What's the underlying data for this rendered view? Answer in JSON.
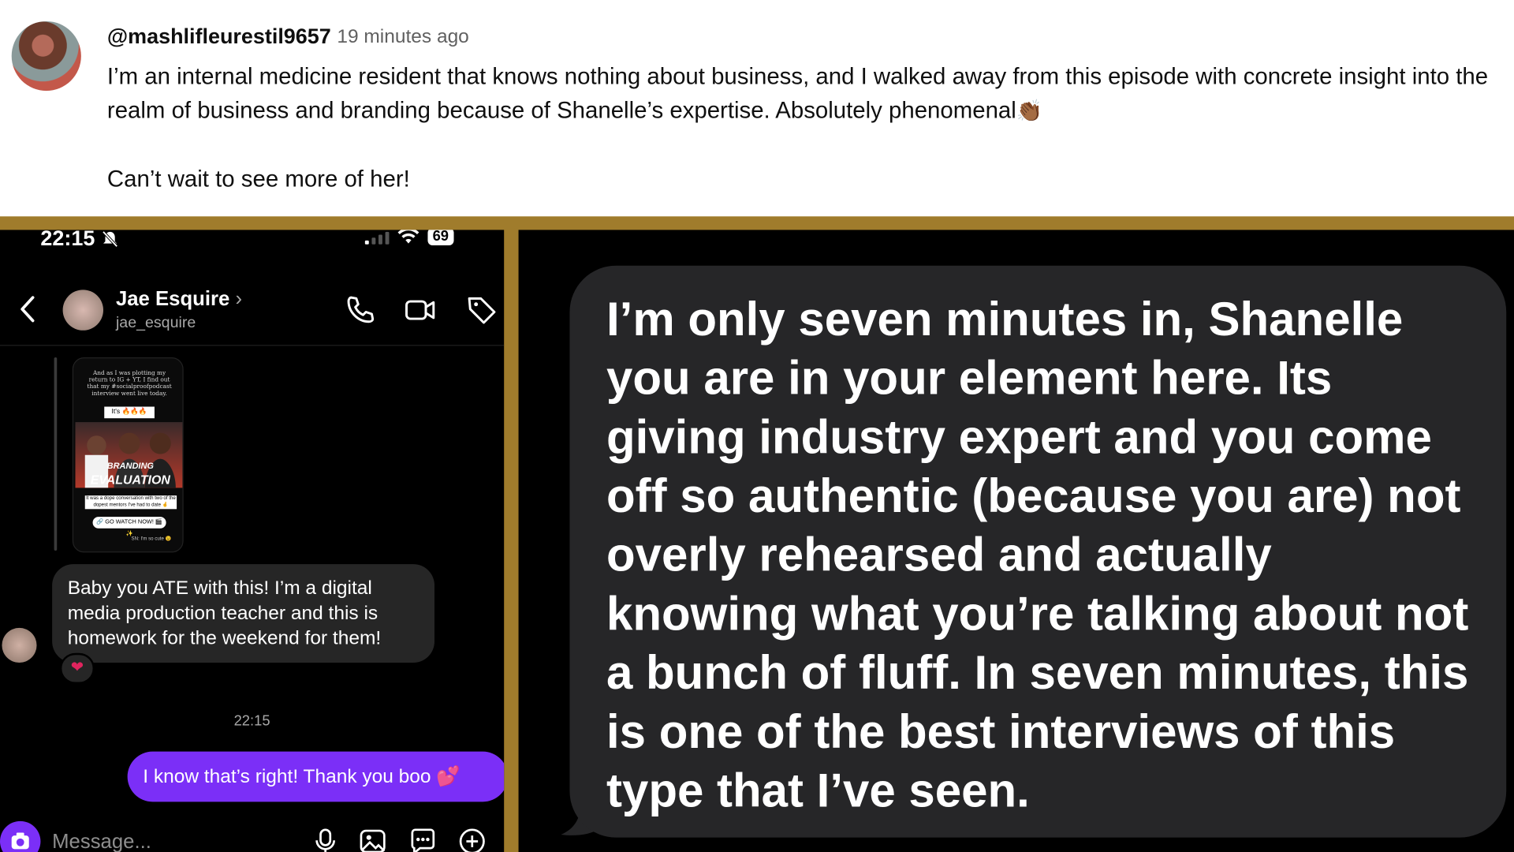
{
  "comment": {
    "handle": "@mashlifleurestil9657",
    "time_ago": "19 minutes ago",
    "text": "I’m an internal medicine resident that knows nothing about business, and I walked away from this episode with concrete insight into the realm of business and branding because of Shanelle’s expertise. Absolutely phenomenal",
    "emoji": "👏🏾",
    "text2": "Can’t wait to see more of her!"
  },
  "phone": {
    "status_time": "22:15",
    "battery": "69",
    "contact_name": "Jae Esquire",
    "contact_username": "jae_esquire",
    "story": {
      "caption_top": "And as I was plotting my return to IG + YT, I find out that my #socialproofpodcast interview went live today.",
      "chip": "It's 🔥🔥🔥",
      "title_small": "BRANDING",
      "title_big": "EVALUATION",
      "caption_bottom": "It was a dope conversation with two of the dopest mentors I've had to date 🤞",
      "cta": "🔗 GO WATCH NOW! 🎬 ✨",
      "signature": "SN: I'm so cute 😉"
    },
    "message_in": "Baby you ATE with this! I’m a digital media production teacher and this is homework for the weekend for them!",
    "reaction": "❤",
    "timestamp": "22:15",
    "message_out": "I know that’s right! Thank you boo 💕",
    "composer_placeholder": "Message..."
  },
  "note": {
    "text": "I’m only seven minutes in, Shanelle you are in your element here. Its giving industry expert and you come off so authentic (because you are) not overly rehearsed and actually knowing what you’re talking about not a bunch of fluff. In seven minutes, this is one of the best interviews of this type that I’ve seen."
  },
  "colors": {
    "frame": "#a07c2c",
    "accent": "#7b2ff7",
    "bubble_dark": "#262626"
  }
}
